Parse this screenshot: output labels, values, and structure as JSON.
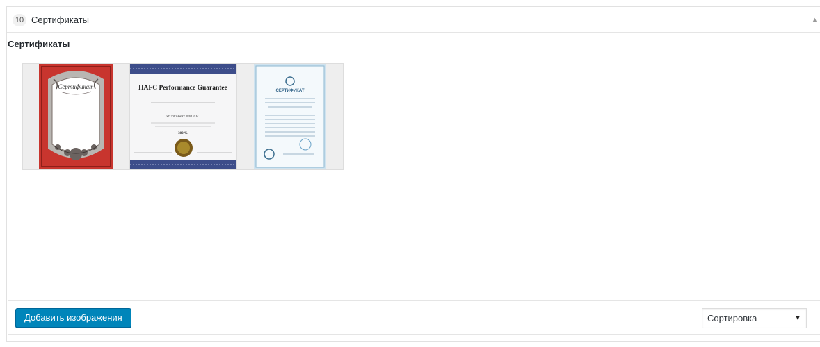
{
  "section": {
    "number": "10",
    "title": "Сертификаты",
    "collapse_icon": "triangle-up-icon"
  },
  "gallery": {
    "label": "Сертификаты",
    "images": [
      {
        "name": "certificate-ornate-red",
        "text": "Сертификат"
      },
      {
        "name": "certificate-hafc",
        "title": "HAFC Performance Guarantee",
        "subtitle": "STUDIO AWAY PUBLICAL",
        "value": "300 %"
      },
      {
        "name": "certificate-blue",
        "title": "СЕРТИФИКАТ"
      }
    ]
  },
  "toolbar": {
    "add_label": "Добавить изображения",
    "sort_label": "Сортировка",
    "sort_icon": "select-arrow-icon"
  },
  "colors": {
    "primary_button": "#0085ba",
    "border": "#e5e5e5"
  }
}
